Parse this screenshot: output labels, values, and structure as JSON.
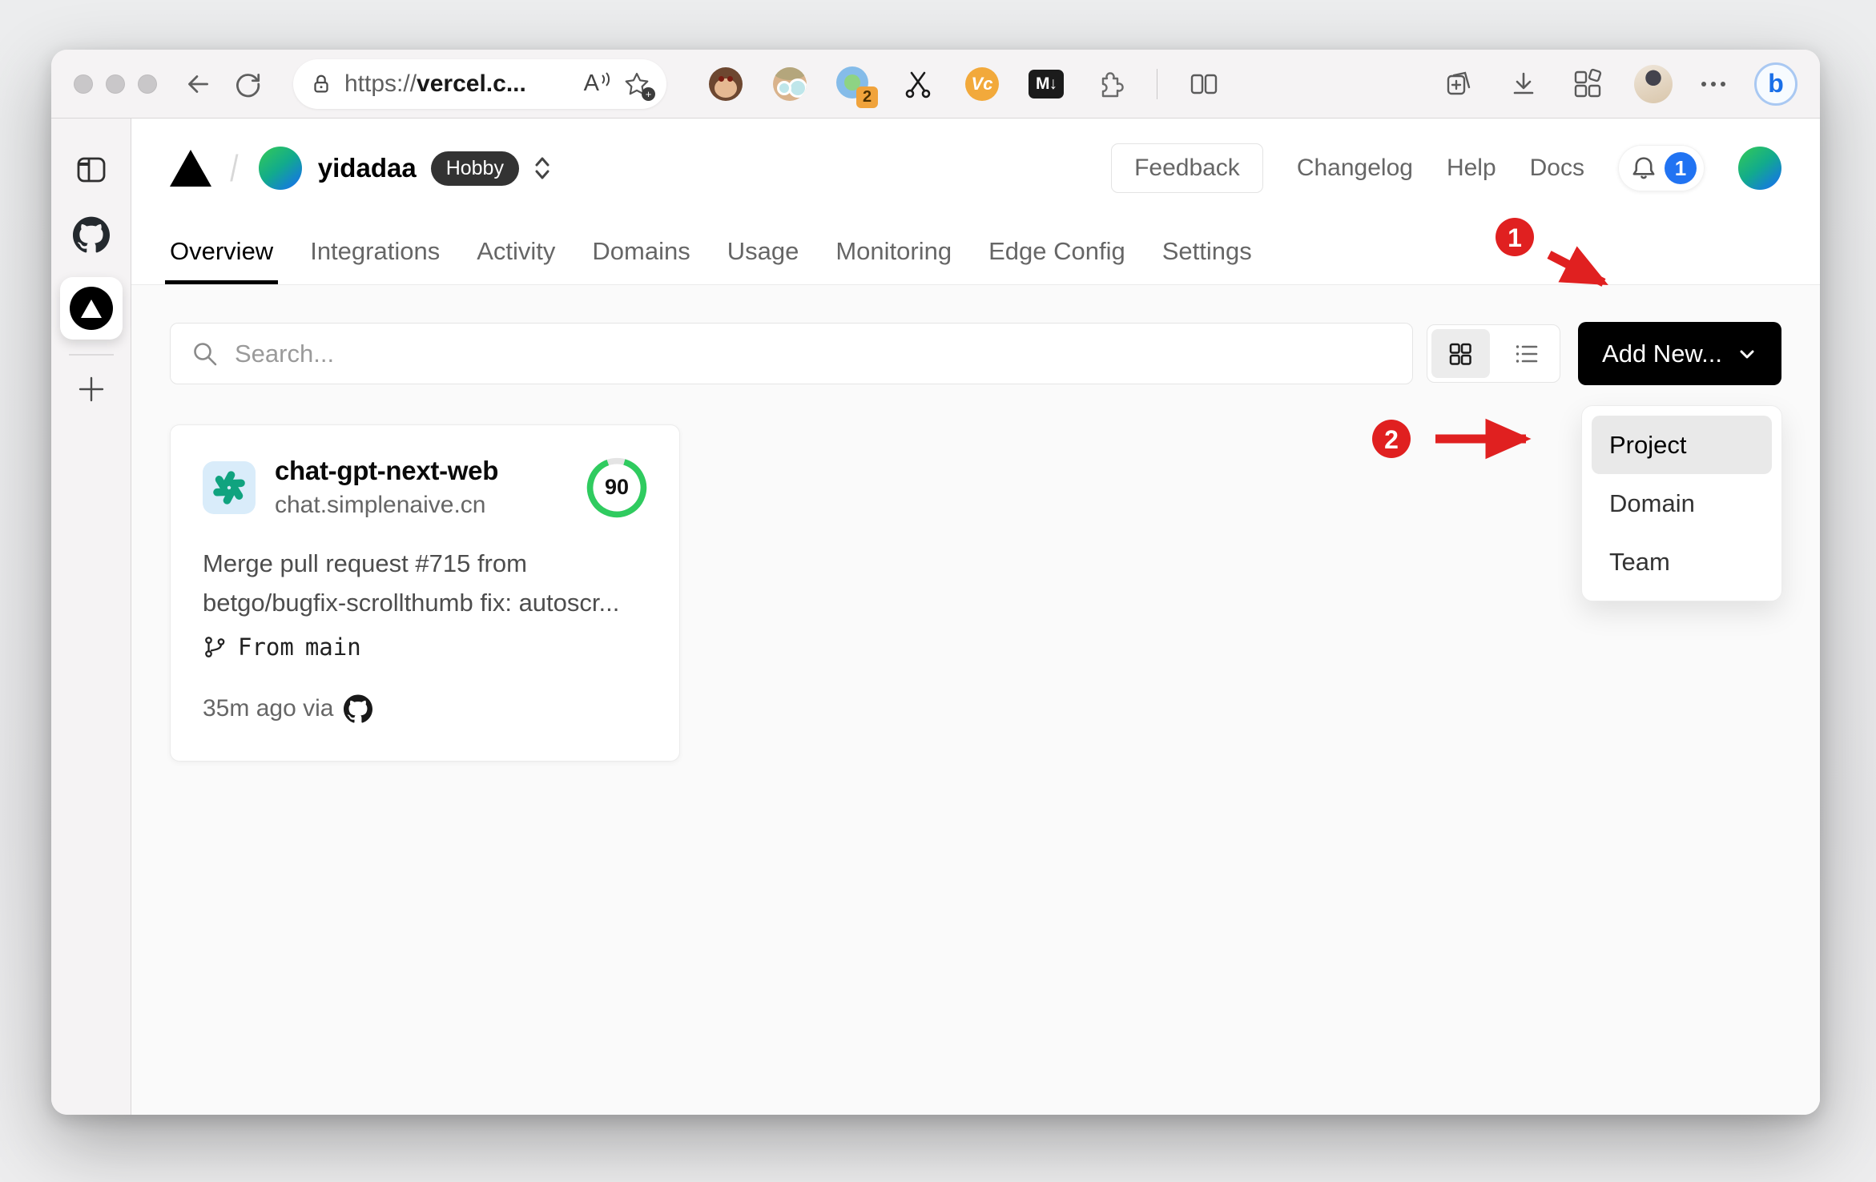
{
  "colors": {
    "annotation_red": "#e02020",
    "notification_blue": "#2173f2",
    "score_green": "#2fcb5f",
    "openai_teal": "#10a37f",
    "hobby_badge_bg": "#333333",
    "add_new_bg": "#000000"
  },
  "browser": {
    "address": {
      "scheme": "https://",
      "host": "vercel.c..."
    },
    "read_aloud_label": "A",
    "extensions": {
      "badge_count": "2",
      "vc_label": "Vc",
      "markdown_label": "M↓"
    },
    "bing_label": "b"
  },
  "vercel": {
    "header": {
      "team": "yidadaa",
      "plan": "Hobby",
      "feedback": "Feedback",
      "links": [
        {
          "label": "Changelog"
        },
        {
          "label": "Help"
        },
        {
          "label": "Docs"
        }
      ],
      "notification_count": "1"
    },
    "tabs": [
      {
        "label": "Overview",
        "active": true
      },
      {
        "label": "Integrations",
        "active": false
      },
      {
        "label": "Activity",
        "active": false
      },
      {
        "label": "Domains",
        "active": false
      },
      {
        "label": "Usage",
        "active": false
      },
      {
        "label": "Monitoring",
        "active": false
      },
      {
        "label": "Edge Config",
        "active": false
      },
      {
        "label": "Settings",
        "active": false
      }
    ],
    "toolbar": {
      "search_placeholder": "Search...",
      "add_new": "Add New..."
    },
    "dropdown": {
      "items": [
        {
          "label": "Project"
        },
        {
          "label": "Domain"
        },
        {
          "label": "Team"
        }
      ]
    },
    "card": {
      "name": "chat-gpt-next-web",
      "domain": "chat.simplenaive.cn",
      "score": "90",
      "commit_lines": [
        "Merge pull request #715 from",
        "betgo/bugfix-scrollthumb fix: autoscr..."
      ],
      "branch_label": "From",
      "branch": "main",
      "deployed": "35m ago via"
    }
  },
  "annotations": {
    "step1": "1",
    "step2": "2"
  }
}
